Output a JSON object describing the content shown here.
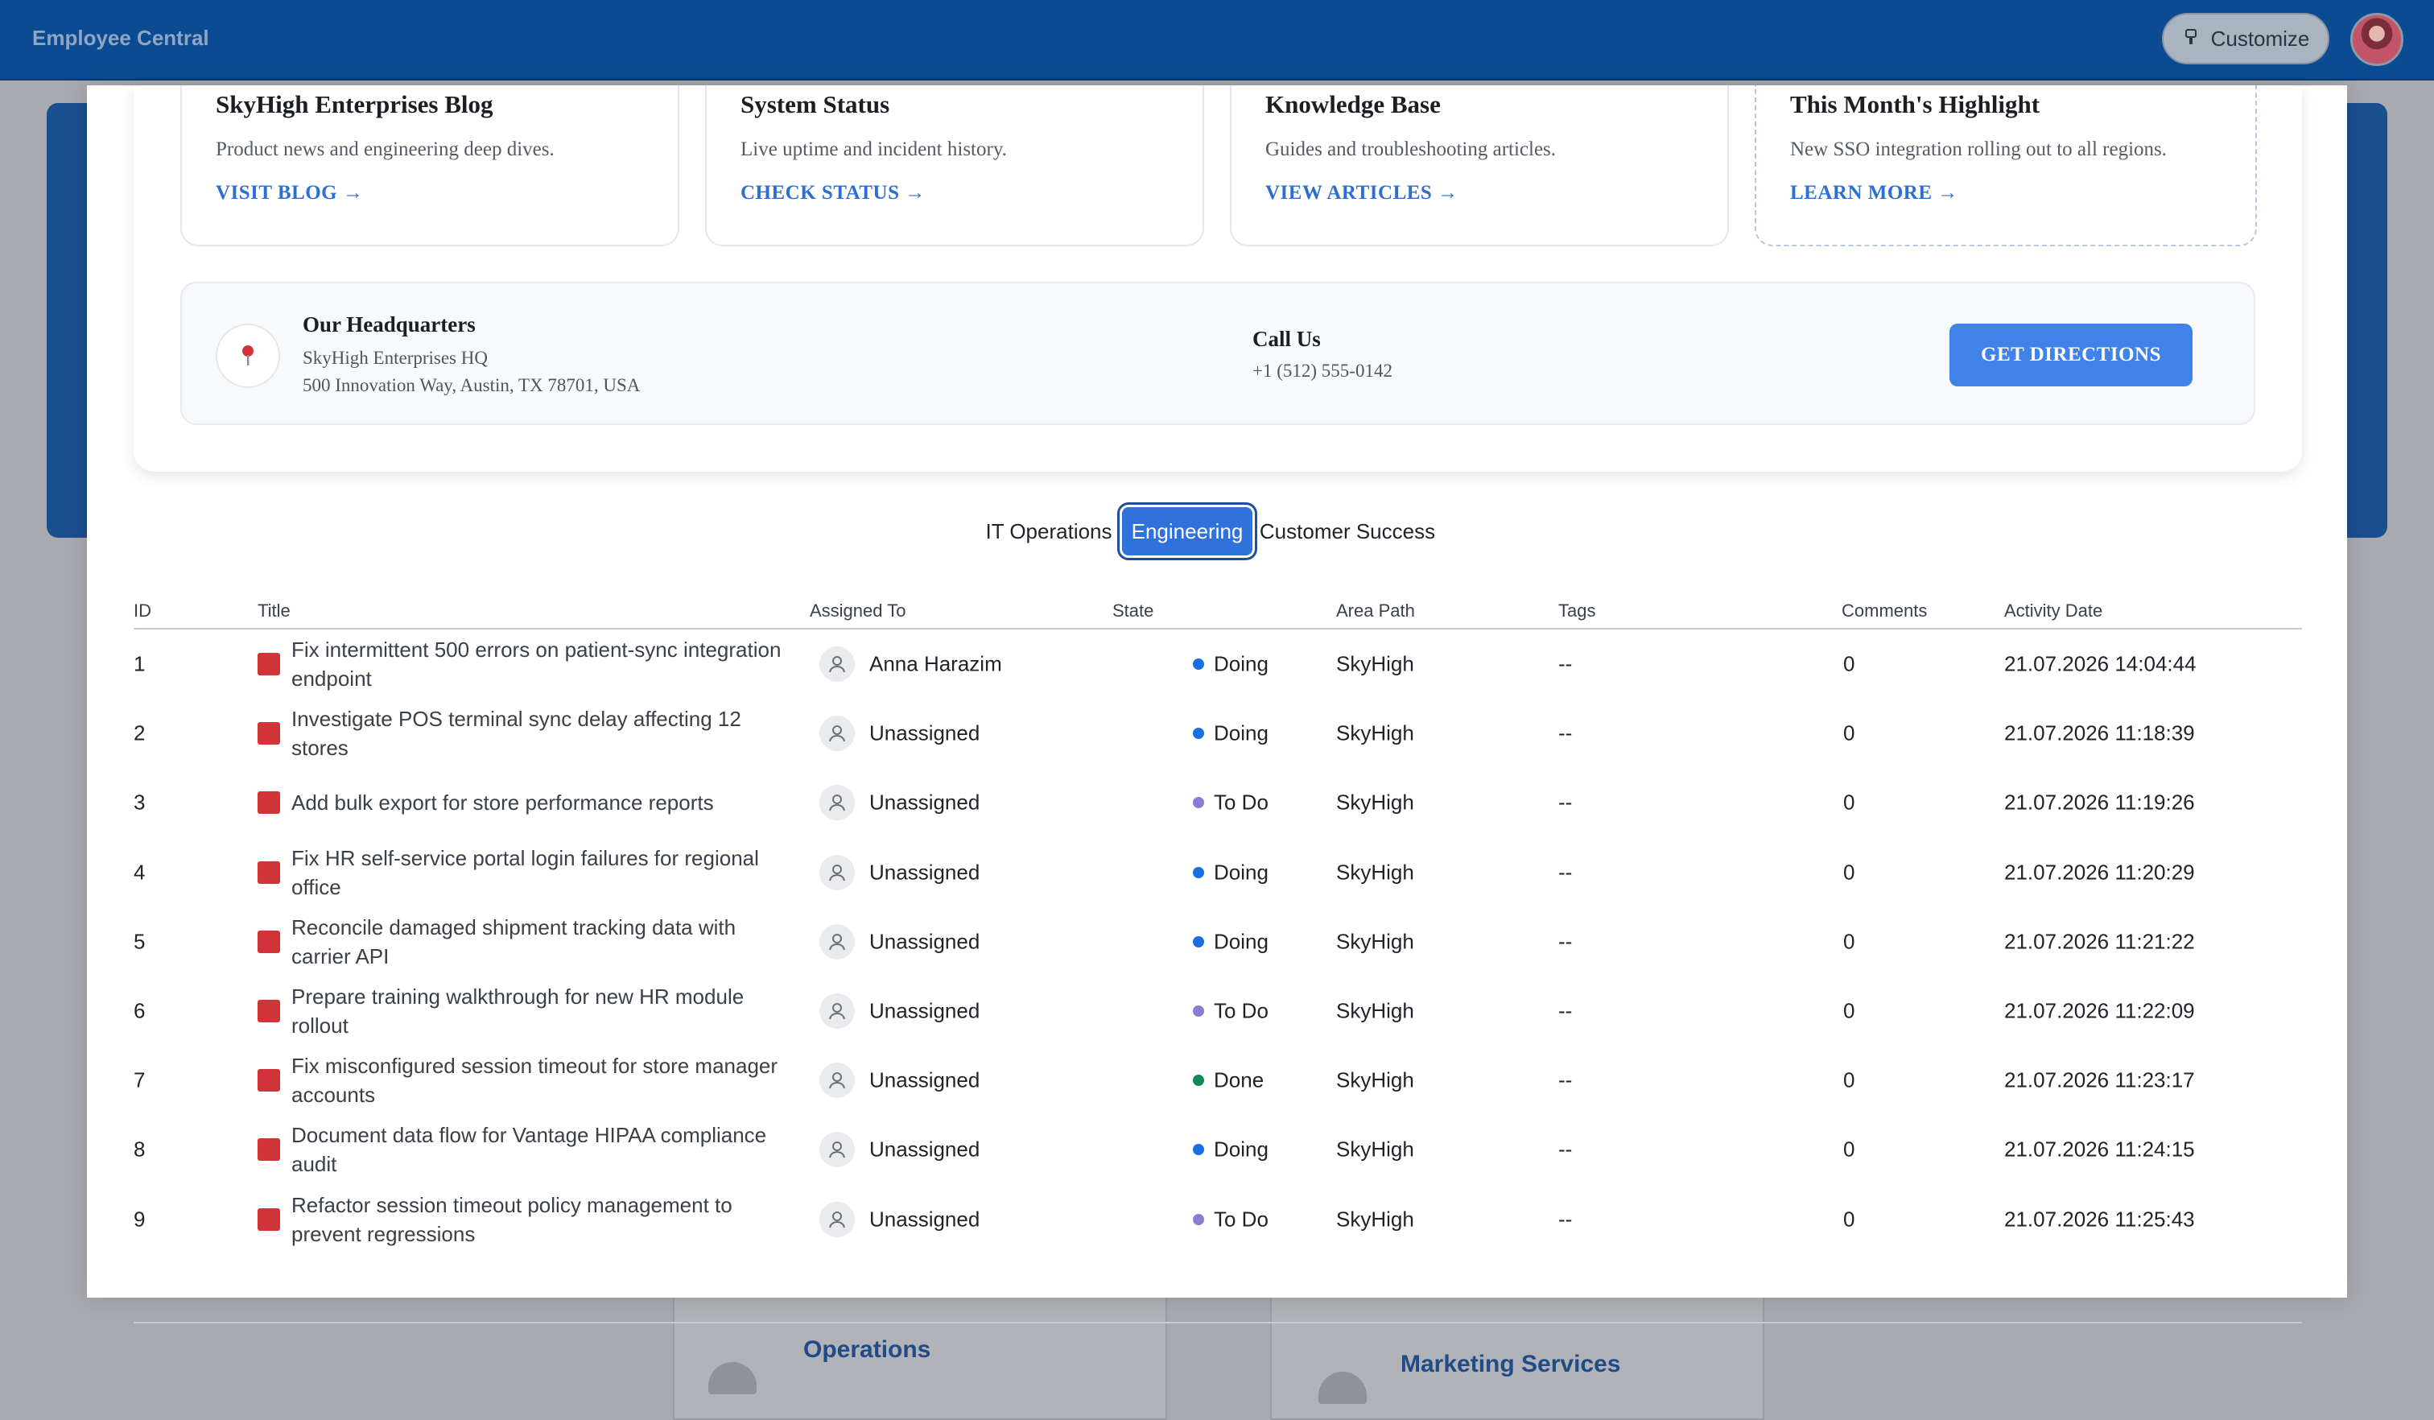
{
  "app": {
    "title": "Employee Central",
    "customize_label": "Customize"
  },
  "background": {
    "cards": [
      {
        "title": "Operations"
      },
      {
        "title": "Marketing Services"
      }
    ]
  },
  "link_cards": [
    {
      "title": "SkyHigh Enterprises Blog",
      "description": "Product news and engineering deep dives.",
      "link": "VISIT BLOG →"
    },
    {
      "title": "System Status",
      "description": "Live uptime and incident history.",
      "link": "CHECK STATUS →"
    },
    {
      "title": "Knowledge Base",
      "description": "Guides and troubleshooting articles.",
      "link": "VIEW ARTICLES →"
    },
    {
      "title": "This Month's Highlight",
      "description": "New SSO integration rolling out to all regions.",
      "link": "LEARN MORE →"
    }
  ],
  "headquarters": {
    "title": "Our Headquarters",
    "name": "SkyHigh Enterprises HQ",
    "address": "500 Innovation Way, Austin, TX 78701, USA",
    "call_title": "Call Us",
    "phone": "+1 (512) 555-0142",
    "directions_label": "GET DIRECTIONS"
  },
  "tabs": [
    {
      "label": "IT Operations",
      "active": false
    },
    {
      "label": "Engineering",
      "active": true
    },
    {
      "label": "Customer Success",
      "active": false
    }
  ],
  "table": {
    "columns": [
      "ID",
      "Title",
      "Assigned To",
      "State",
      "Area Path",
      "Tags",
      "Comments",
      "Activity Date"
    ],
    "state_colors": {
      "Doing": "#1a6fe0",
      "To Do": "#8d7ad6",
      "Done": "#0f8a55"
    },
    "rows": [
      {
        "id": "1",
        "title": "Fix intermittent 500 errors on patient-sync integration endpoint",
        "assigned": "Anna Harazim",
        "state": "Doing",
        "area": "SkyHigh",
        "tags": "--",
        "comments": "0",
        "date": "21.07.2026 14:04:44"
      },
      {
        "id": "2",
        "title": "Investigate POS terminal sync delay affecting 12 stores",
        "assigned": "Unassigned",
        "state": "Doing",
        "area": "SkyHigh",
        "tags": "--",
        "comments": "0",
        "date": "21.07.2026 11:18:39"
      },
      {
        "id": "3",
        "title": "Add bulk export for store performance reports",
        "assigned": "Unassigned",
        "state": "To Do",
        "area": "SkyHigh",
        "tags": "--",
        "comments": "0",
        "date": "21.07.2026 11:19:26"
      },
      {
        "id": "4",
        "title": "Fix HR self-service portal login failures for regional office",
        "assigned": "Unassigned",
        "state": "Doing",
        "area": "SkyHigh",
        "tags": "--",
        "comments": "0",
        "date": "21.07.2026 11:20:29"
      },
      {
        "id": "5",
        "title": "Reconcile damaged shipment tracking data with carrier API",
        "assigned": "Unassigned",
        "state": "Doing",
        "area": "SkyHigh",
        "tags": "--",
        "comments": "0",
        "date": "21.07.2026 11:21:22"
      },
      {
        "id": "6",
        "title": "Prepare training walkthrough for new HR module rollout",
        "assigned": "Unassigned",
        "state": "To Do",
        "area": "SkyHigh",
        "tags": "--",
        "comments": "0",
        "date": "21.07.2026 11:22:09"
      },
      {
        "id": "7",
        "title": "Fix misconfigured session timeout for store manager accounts",
        "assigned": "Unassigned",
        "state": "Done",
        "area": "SkyHigh",
        "tags": "--",
        "comments": "0",
        "date": "21.07.2026 11:23:17"
      },
      {
        "id": "8",
        "title": "Document data flow for Vantage HIPAA compliance audit",
        "assigned": "Unassigned",
        "state": "Doing",
        "area": "SkyHigh",
        "tags": "--",
        "comments": "0",
        "date": "21.07.2026 11:24:15"
      },
      {
        "id": "9",
        "title": "Refactor session timeout policy management to prevent regressions",
        "assigned": "Unassigned",
        "state": "To Do",
        "area": "SkyHigh",
        "tags": "--",
        "comments": "0",
        "date": "21.07.2026 11:25:43"
      }
    ]
  }
}
